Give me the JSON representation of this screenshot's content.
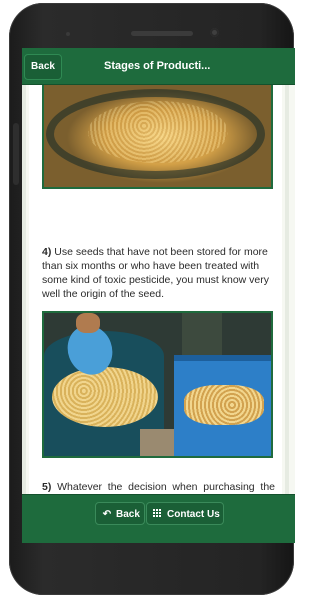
{
  "header": {
    "back_label": "Back",
    "title": "Stages of Producti..."
  },
  "content": {
    "para4_number": "4)",
    "para4_text": " Use seeds that have not been stored for more than six months or who have been treated with some kind of toxic pesticide, you must know very well the origin of the seed.",
    "para5_number": "5)",
    "para5_text": " Whatever the decision when purchasing the seed is very important to do good agricultural practices both in sowing, harvesting and storage."
  },
  "footer": {
    "back_label": "Back",
    "contact_label": "Contact Us"
  },
  "icons": {
    "back_arrow": "reply-arrow-icon",
    "contact": "grid-icon"
  },
  "colors": {
    "header_green": "#1e6b3d",
    "footer_green": "#1e6b3d",
    "image_border": "#1f6b3d"
  }
}
